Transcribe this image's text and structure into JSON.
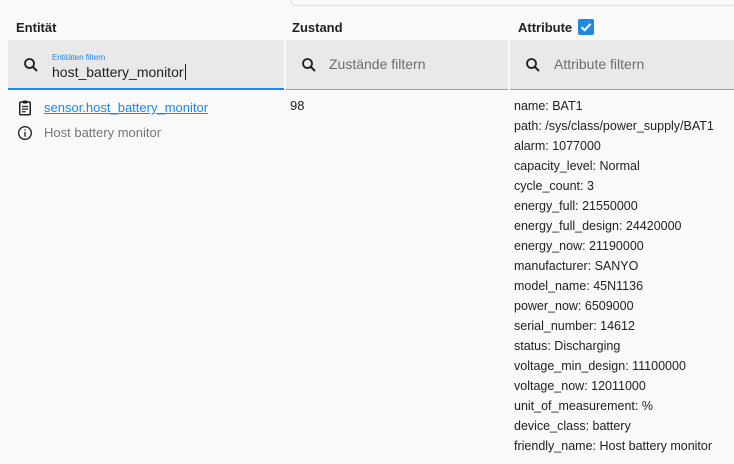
{
  "headers": {
    "entity": "Entität",
    "state": "Zustand",
    "attributes": "Attribute"
  },
  "attributes_checkbox_checked": true,
  "filters": {
    "entity": {
      "label": "Entitäten filtern",
      "value": "host_battery_monitor"
    },
    "state": {
      "placeholder": "Zustände filtern"
    },
    "attributes": {
      "placeholder": "Attribute filtern"
    }
  },
  "row": {
    "entity_id": "sensor.host_battery_monitor",
    "friendly_name": "Host battery monitor",
    "state": "98",
    "attributes": [
      "name: BAT1",
      "path: /sys/class/power_supply/BAT1",
      "alarm: 1077000",
      "capacity_level: Normal",
      "cycle_count: 3",
      "energy_full: 21550000",
      "energy_full_design: 24420000",
      "energy_now: 21190000",
      "manufacturer: SANYO",
      "model_name: 45N1136",
      "power_now: 6509000",
      "serial_number: 14612",
      "status: Discharging",
      "voltage_min_design: 11100000",
      "voltage_now: 12011000",
      "unit_of_measurement: %",
      "device_class: battery",
      "friendly_name: Host battery monitor"
    ]
  },
  "icons": {
    "filter": "search-icon",
    "entity_more_info": "clipboard-icon",
    "info": "info-icon"
  },
  "colors": {
    "accent": "#1e88e5",
    "filter_bg": "#e9e9e9"
  }
}
